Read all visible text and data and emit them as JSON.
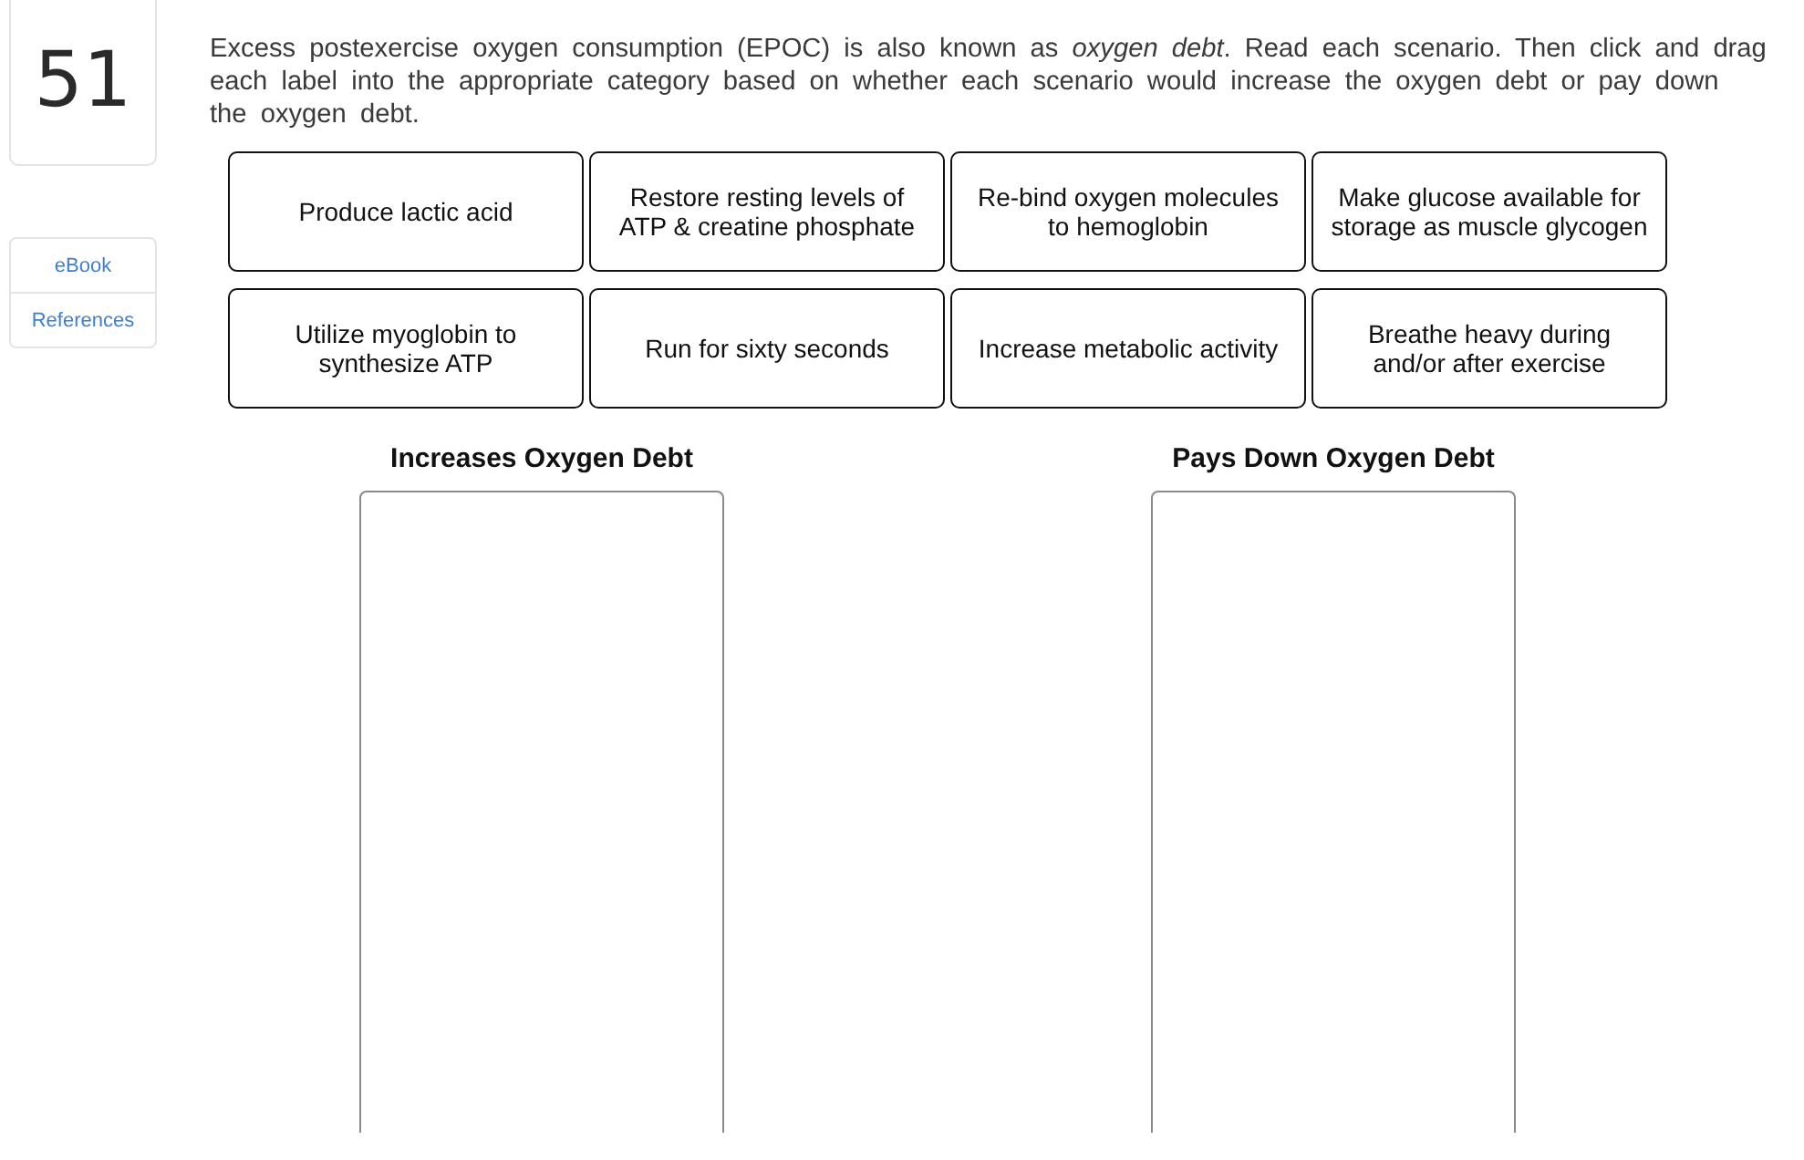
{
  "question": {
    "number": "51",
    "text": "Excess postexercise oxygen consumption (EPOC) is also known as *oxygen debt*. Read each scenario. Then click and drag each label into the appropriate category based on whether each scenario would increase the oxygen debt or pay down the oxygen debt."
  },
  "resources": [
    {
      "label": "eBook"
    },
    {
      "label": "References"
    }
  ],
  "labels": [
    {
      "text": "Produce lactic acid"
    },
    {
      "text": "Restore resting levels of\nATP & creatine phosphate"
    },
    {
      "text": "Re-bind oxygen molecules\nto hemoglobin"
    },
    {
      "text": "Make glucose available for\nstorage as muscle glycogen"
    },
    {
      "text": "Utilize myoglobin to\nsynthesize ATP"
    },
    {
      "text": "Run for sixty seconds"
    },
    {
      "text": "Increase metabolic activity"
    },
    {
      "text": "Breathe heavy during\nand/or after exercise"
    }
  ],
  "categories": [
    {
      "title": "Increases Oxygen Debt"
    },
    {
      "title": "Pays Down Oxygen Debt"
    }
  ]
}
